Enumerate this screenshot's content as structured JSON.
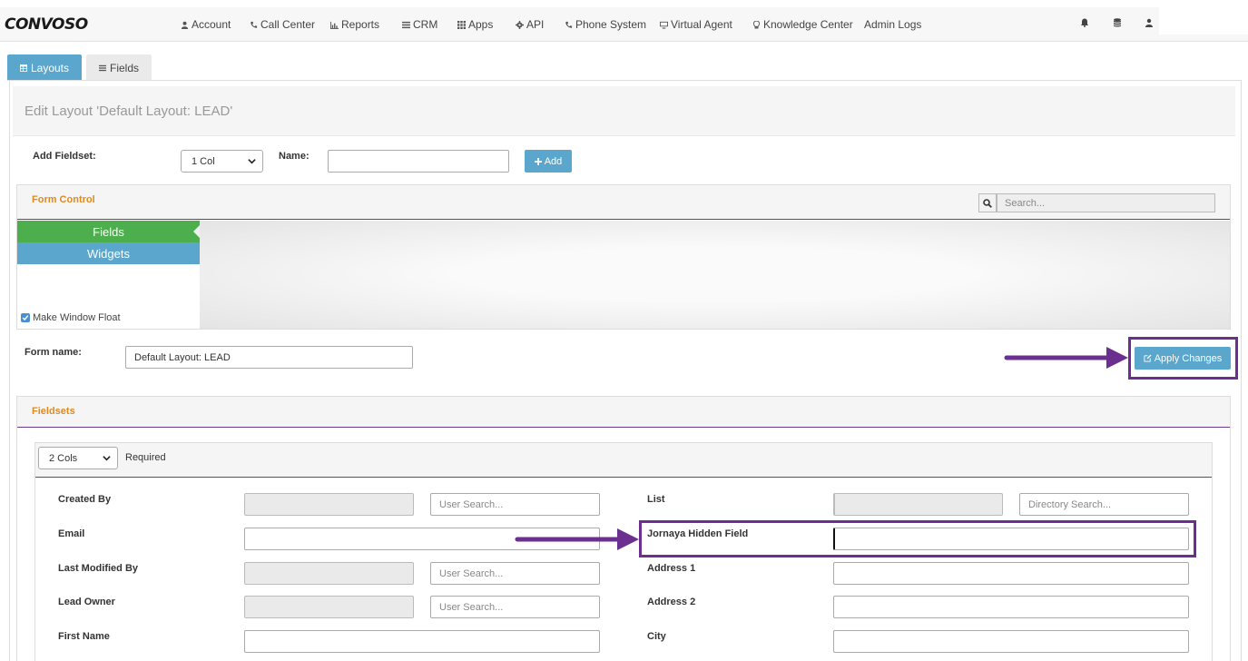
{
  "navbar": {
    "logo": "CONVOSO",
    "items": [
      {
        "label": "Account",
        "icon": "user-icon"
      },
      {
        "label": "Call Center",
        "icon": "phone-icon"
      },
      {
        "label": "Reports",
        "icon": "bar-chart-icon"
      },
      {
        "label": "CRM",
        "icon": "list-icon"
      },
      {
        "label": "Apps",
        "icon": "grid-icon"
      },
      {
        "label": "API",
        "icon": "gear-icon"
      },
      {
        "label": "Phone System",
        "icon": "phone-icon"
      },
      {
        "label": "Virtual Agent",
        "icon": "monitor-icon"
      },
      {
        "label": "Knowledge Center",
        "icon": "lightbulb-icon"
      },
      {
        "label": "Admin Logs",
        "icon": ""
      }
    ],
    "right_icons": [
      "bell-icon",
      "database-icon",
      "user-icon"
    ]
  },
  "tabs": [
    {
      "label": "Layouts",
      "active": true
    },
    {
      "label": "Fields",
      "active": false
    }
  ],
  "page": {
    "title": "Edit Layout 'Default Layout: LEAD'"
  },
  "add_fieldset": {
    "label": "Add Fieldset:",
    "cols_value": "1 Col",
    "name_label": "Name:",
    "name_value": "",
    "add_button": "Add"
  },
  "form_control": {
    "title": "Form Control",
    "search_placeholder": "Search...",
    "fields_button": "Fields",
    "widgets_button": "Widgets",
    "float_label": "Make Window Float",
    "float_checked": true
  },
  "form_name": {
    "label": "Form name:",
    "value": "Default Layout: LEAD"
  },
  "apply_button": "Apply Changes",
  "fieldsets": {
    "title": "Fieldsets",
    "cols_value": "2 Cols",
    "required_label": "Required",
    "left_fields": [
      {
        "label": "Created By",
        "search_placeholder": "User Search..."
      },
      {
        "label": "Email"
      },
      {
        "label": "Last Modified By",
        "search_placeholder": "User Search..."
      },
      {
        "label": "Lead Owner",
        "search_placeholder": "User Search..."
      },
      {
        "label": "First Name"
      }
    ],
    "right_fields": [
      {
        "label": "List",
        "search_placeholder": "Directory Search..."
      },
      {
        "label": "Jornaya Hidden Field"
      },
      {
        "label": "Address 1"
      },
      {
        "label": "Address 2"
      },
      {
        "label": "City"
      }
    ]
  },
  "colors": {
    "accent_blue": "#5ba6cc",
    "fields_green": "#4cae4c",
    "highlight_purple": "#6b2f8f",
    "section_orange": "#e08a1e"
  }
}
